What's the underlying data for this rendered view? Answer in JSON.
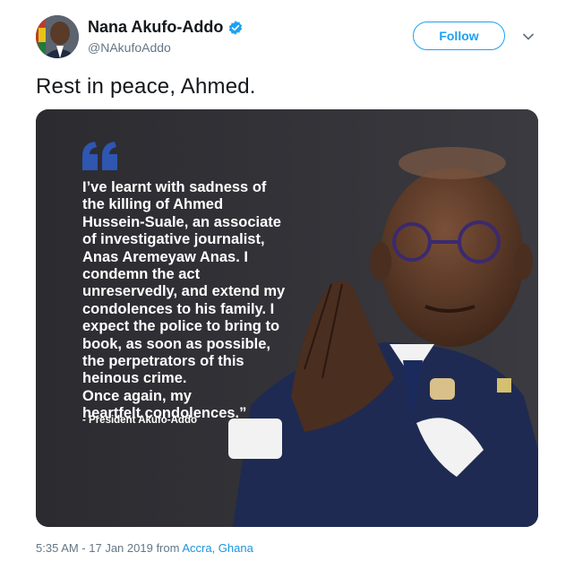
{
  "author": {
    "display_name": "Nana Akufo-Addo",
    "handle": "@NAkufoAddo",
    "verified_icon": "verified-badge-icon",
    "avatar_icon": "avatar"
  },
  "actions": {
    "follow_label": "Follow",
    "more_icon": "chevron-down-icon"
  },
  "tweet": {
    "text": "Rest in peace, Ahmed."
  },
  "media": {
    "quote_icon": "quote-mark-icon",
    "quote_lines": [
      "I’ve learnt with sadness of",
      "the killing of Ahmed",
      "Hussein-Suale, an associate",
      "of investigative journalist,",
      "Anas Aremeyaw Anas. I",
      "condemn the act",
      "unreservedly, and extend my",
      "condolences to his family. I",
      "expect the police to bring to",
      "book, as soon as possible,",
      "the perpetrators of this",
      "heinous crime.",
      "Once again, my",
      "heartfelt condolences.”"
    ],
    "attribution": "- President Akufo-Addo"
  },
  "footer": {
    "timestamp": "5:35 AM - 17 Jan 2019",
    "from_word": "from",
    "location": "Accra, Ghana"
  },
  "colors": {
    "accent": "#1da1f2",
    "link": "#1b95e0",
    "card_bg": "#2e2e33",
    "quote_mark": "#2f56b0"
  }
}
